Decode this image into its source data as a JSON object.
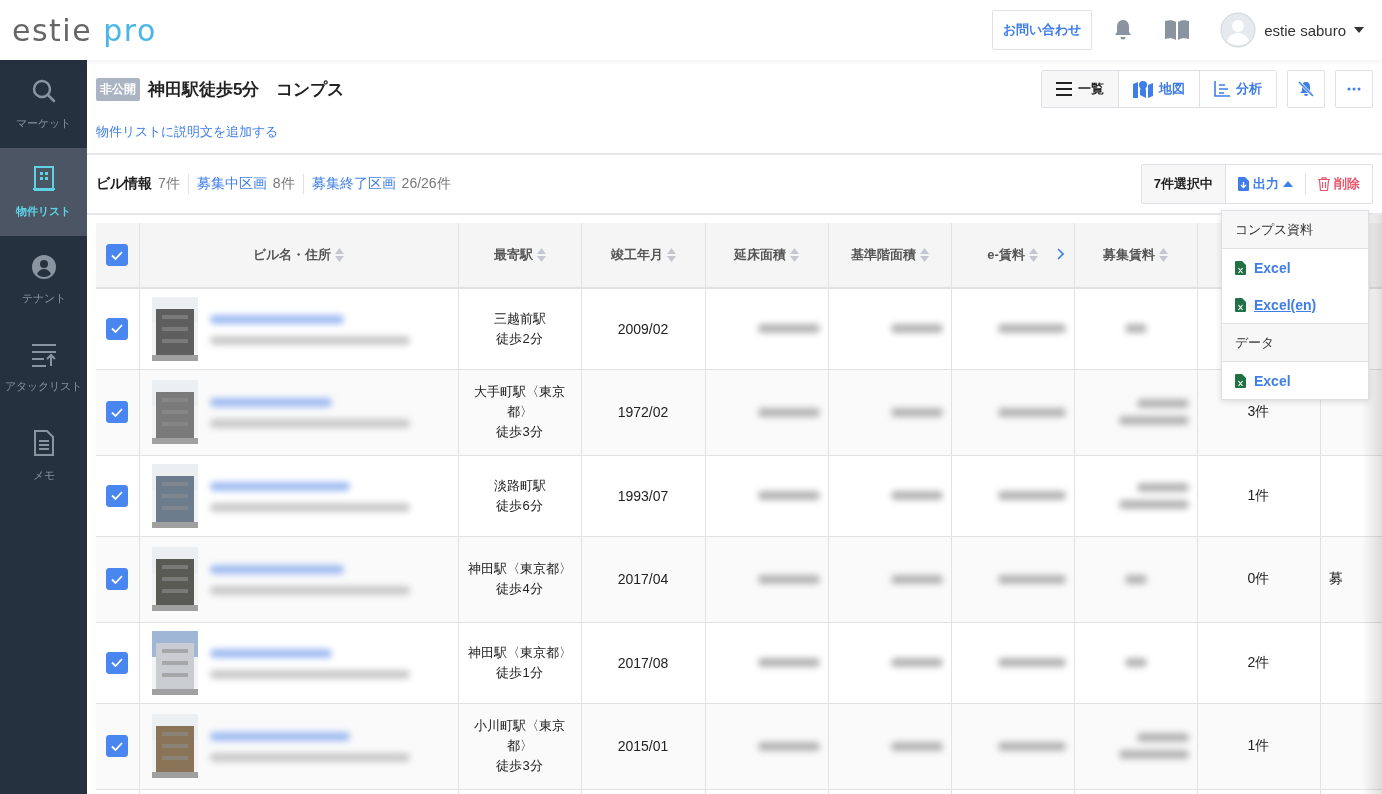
{
  "app": {
    "logo_main": "estie",
    "logo_accent": "pro"
  },
  "header": {
    "contact_button": "お問い合わせ",
    "user_name": "estie saburo"
  },
  "sidebar": {
    "items": [
      {
        "label": "マーケット",
        "kind": "search",
        "selected": false
      },
      {
        "label": "物件リスト",
        "kind": "building",
        "selected": true
      },
      {
        "label": "テナント",
        "kind": "person",
        "selected": false
      },
      {
        "label": "アタックリスト",
        "kind": "attack",
        "selected": false
      },
      {
        "label": "メモ",
        "kind": "memo",
        "selected": false
      }
    ]
  },
  "list": {
    "badge": "非公開",
    "title": "神田駅徒歩5分　コンプス",
    "description_link": "物件リストに説明文を追加する"
  },
  "view_buttons": [
    {
      "label": "一覧",
      "kind": "list",
      "selected": true
    },
    {
      "label": "地図",
      "kind": "map",
      "selected": false
    },
    {
      "label": "分析",
      "kind": "chart",
      "selected": false
    }
  ],
  "tabs": [
    {
      "label": "ビル情報",
      "count": "7件",
      "selected": true
    },
    {
      "label": "募集中区画",
      "count": "8件",
      "selected": false
    },
    {
      "label": "募集終了区画",
      "count": "26/26件",
      "selected": false
    }
  ],
  "selection": {
    "count_label": "7件選択中",
    "export_button": "出力",
    "export_expanded": true,
    "delete_button": "削除"
  },
  "export_menu": {
    "sections": [
      {
        "heading": "コンプス資料",
        "items": [
          {
            "label": "Excel",
            "hovered": false
          },
          {
            "label": "Excel(en)",
            "hovered": true
          }
        ]
      },
      {
        "heading": "データ",
        "items": [
          {
            "label": "Excel",
            "hovered": false
          }
        ]
      }
    ]
  },
  "table": {
    "all_checked": true,
    "columns": [
      "ビル名・住所",
      "最寄駅",
      "竣工年月",
      "延床面積",
      "基準階面積",
      "e-賃料",
      "募集賃料"
    ],
    "rows": [
      {
        "checked": true,
        "station": "三越前駅",
        "walk": "徒歩2分",
        "built": "2009/02",
        "rent_range": false
      },
      {
        "checked": true,
        "station": "大手町駅〈東京都〉",
        "walk": "徒歩3分",
        "built": "1972/02",
        "rent_range": true,
        "count": "3件"
      },
      {
        "checked": true,
        "station": "淡路町駅",
        "walk": "徒歩6分",
        "built": "1993/07",
        "rent_range": true,
        "count": "1件"
      },
      {
        "checked": true,
        "station": "神田駅〈東京都〉",
        "walk": "徒歩4分",
        "built": "2017/04",
        "rent_range": false,
        "count": "0件",
        "extra": "募"
      },
      {
        "checked": true,
        "station": "神田駅〈東京都〉",
        "walk": "徒歩1分",
        "built": "2017/08",
        "rent_range": false,
        "count": "2件"
      },
      {
        "checked": true,
        "station": "小川町駅〈東京都〉",
        "walk": "徒歩3分",
        "built": "2015/01",
        "rent_range": true,
        "count": "1件"
      }
    ]
  }
}
